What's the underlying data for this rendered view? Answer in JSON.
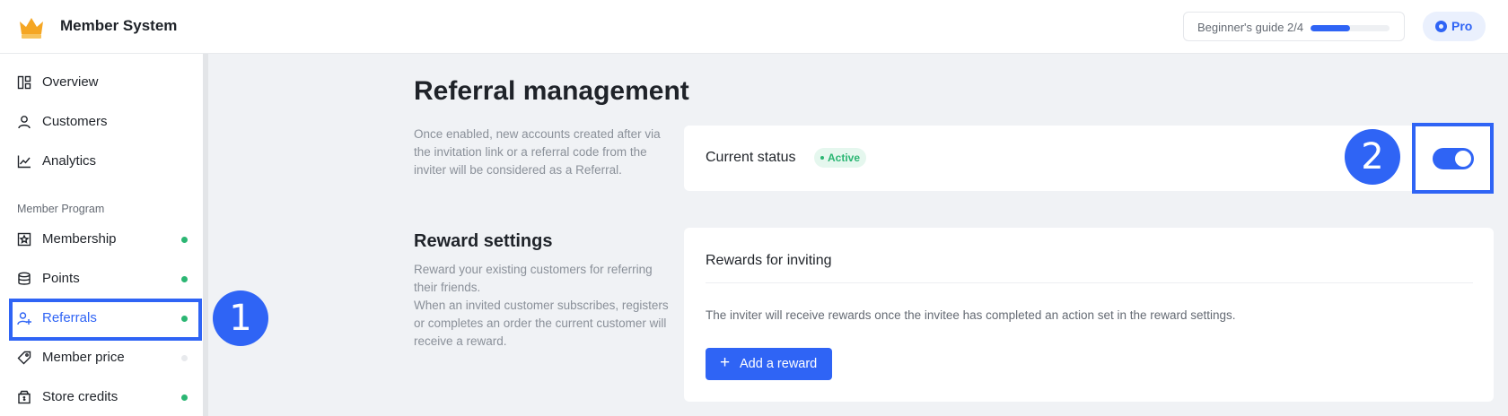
{
  "app": {
    "title": "Member System",
    "logo": "crown-icon"
  },
  "header": {
    "guide_label": "Beginner's guide 2/4",
    "guide_progress": 0.5,
    "pro_label": "Pro"
  },
  "sidebar": {
    "items": [
      {
        "label": "Overview",
        "icon": "overview-icon"
      },
      {
        "label": "Customers",
        "icon": "user-icon"
      },
      {
        "label": "Analytics",
        "icon": "chart-line-icon"
      }
    ],
    "section_label": "Member Program",
    "program_items": [
      {
        "label": "Membership",
        "icon": "badge-icon",
        "status": "enabled"
      },
      {
        "label": "Points",
        "icon": "coins-icon",
        "status": "enabled"
      },
      {
        "label": "Referrals",
        "icon": "user-plus-icon",
        "status": "enabled",
        "active": true
      },
      {
        "label": "Member price",
        "icon": "tag-icon",
        "status": "disabled"
      },
      {
        "label": "Store credits",
        "icon": "wallet-icon",
        "status": "enabled"
      }
    ]
  },
  "annotations": {
    "step1": "1",
    "step2": "2"
  },
  "main": {
    "title": "Referral management",
    "intro_description": "Once enabled, new accounts created after via the invitation link or a referral code from the inviter will be considered as a Referral.",
    "status": {
      "label": "Current status",
      "badge": "Active",
      "enabled": true
    },
    "reward_settings": {
      "title": "Reward settings",
      "description_1": "Reward your existing customers for referring their friends.",
      "description_2": "When an invited customer subscribes, registers or completes an order the current customer will receive a reward."
    },
    "rewards_card": {
      "heading": "Rewards for inviting",
      "text": "The inviter will receive rewards once the invitee has completed an action set in the reward settings.",
      "add_button_label": "Add a reward"
    }
  },
  "colors": {
    "accent": "#2f64f5",
    "success": "#2bb673",
    "background": "#f0f2f5"
  }
}
